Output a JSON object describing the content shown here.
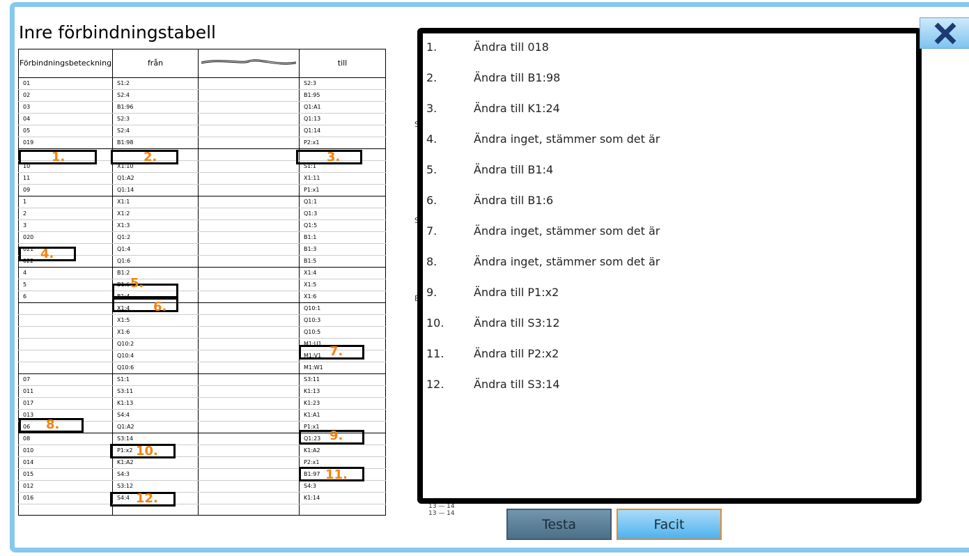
{
  "title": "Inre förbindningstabell",
  "table": {
    "headers": [
      "Förbindningsbeteckning",
      "från",
      "",
      "till"
    ],
    "rows": [
      [
        "01",
        "S1:2",
        "S2:3"
      ],
      [
        "02",
        "S2:4",
        "B1:95"
      ],
      [
        "03",
        "B1:96",
        "Q1:A1"
      ],
      [
        "04",
        "S2:3",
        "Q1:13"
      ],
      [
        "05",
        "S2:4",
        "Q1:14"
      ],
      [
        "019",
        "B1:98",
        "P2:x1"
      ],
      [
        "",
        "",
        ""
      ],
      [
        "10",
        "X1:10",
        "S1:1"
      ],
      [
        "11",
        "Q1:A2",
        "X1:11"
      ],
      [
        "09",
        "Q1:14",
        "P1:x1"
      ],
      [
        "1",
        "X1:1",
        "Q1:1"
      ],
      [
        "2",
        "X1:2",
        "Q1:3"
      ],
      [
        "3",
        "X1:3",
        "Q1:5"
      ],
      [
        "020",
        "Q1:2",
        "B1:1"
      ],
      [
        "021",
        "Q1:4",
        "B1:3"
      ],
      [
        "022",
        "Q1:6",
        "B1:5"
      ],
      [
        "4",
        "B1:2",
        "X1:4"
      ],
      [
        "5",
        "B1:6",
        "X1:5"
      ],
      [
        "6",
        "B1:4",
        "X1:6"
      ],
      [
        "",
        "X1:4",
        "Q10:1"
      ],
      [
        "",
        "X1:5",
        "Q10:3"
      ],
      [
        "",
        "X1:6",
        "Q10:5"
      ],
      [
        "",
        "Q10:2",
        "M1:U1"
      ],
      [
        "",
        "Q10:4",
        "M1:V1"
      ],
      [
        "",
        "Q10:6",
        "M1:W1"
      ],
      [
        "07",
        "S1:1",
        "S3:11"
      ],
      [
        "011",
        "S3:11",
        "K1:13"
      ],
      [
        "017",
        "K1:13",
        "K1:23"
      ],
      [
        "013",
        "S4:4",
        "K1:A1"
      ],
      [
        "06",
        "Q1:A2",
        "P1:x1"
      ],
      [
        "08",
        "S3:14",
        "Q1:23"
      ],
      [
        "010",
        "P1:x2",
        "K1:A2"
      ],
      [
        "014",
        "K1:A2",
        "P2:x1"
      ],
      [
        "015",
        "S4:3",
        "B1:97"
      ],
      [
        "012",
        "S3:12",
        "S4:3"
      ],
      [
        "016",
        "S4:4",
        "K1:14"
      ],
      [
        "",
        "",
        ""
      ]
    ]
  },
  "markers": [
    "1.",
    "2.",
    "3.",
    "4.",
    "5.",
    "6.",
    "7.",
    "8.",
    "9.",
    "10.",
    "11.",
    "12."
  ],
  "answers": [
    {
      "num": "1.",
      "text": "Ändra till 018"
    },
    {
      "num": "2.",
      "text": "Ändra till B1:98"
    },
    {
      "num": "3.",
      "text": "Ändra till K1:24"
    },
    {
      "num": "4.",
      "text": "Ändra inget, stämmer som det är"
    },
    {
      "num": "5.",
      "text": "Ändra till B1:4"
    },
    {
      "num": "6.",
      "text": "Ändra till B1:6"
    },
    {
      "num": "7.",
      "text": "Ändra inget, stämmer som det är"
    },
    {
      "num": "8.",
      "text": "Ändra inget, stämmer som det är"
    },
    {
      "num": "9.",
      "text": "Ändra till P1:x2"
    },
    {
      "num": "10.",
      "text": "Ändra till S3:12"
    },
    {
      "num": "11.",
      "text": "Ändra till P2:x2"
    },
    {
      "num": "12.",
      "text": "Ändra till S3:14"
    }
  ],
  "background_fragments": {
    "s1": "S",
    "s2": "S",
    "e": "E",
    "contact1": "13 — 14",
    "contact2": "13 — 14"
  },
  "buttons": {
    "testa": "Testa",
    "facit": "Facit"
  },
  "close_icon": "close-icon",
  "colors": {
    "frame": "#87c8ee",
    "marker": "#f5820d",
    "facit_border": "#e8882a"
  }
}
